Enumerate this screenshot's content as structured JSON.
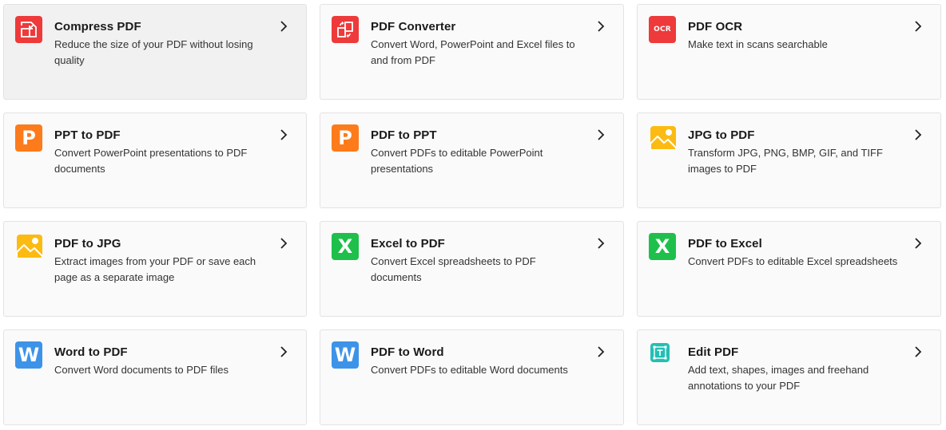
{
  "colors": {
    "red": "#ee3a3a",
    "orange": "#fd7b1b",
    "yellow": "#fbbb12",
    "green": "#1ec04b",
    "blue": "#3d93e8",
    "teal": "#23bfb3"
  },
  "tools": [
    {
      "title": "Compress PDF",
      "description": "Reduce the size of your PDF without losing quality",
      "icon": "compress-icon"
    },
    {
      "title": "PDF Converter",
      "description": "Convert Word, PowerPoint and Excel files to and from PDF",
      "icon": "convert-icon"
    },
    {
      "title": "PDF OCR",
      "description": "Make text in scans searchable",
      "icon": "ocr-icon",
      "icon_text": "OCR"
    },
    {
      "title": "PPT to PDF",
      "description": "Convert PowerPoint presentations to PDF documents",
      "icon": "powerpoint-icon",
      "icon_text": "P"
    },
    {
      "title": "PDF to PPT",
      "description": "Convert PDFs to editable PowerPoint presentations",
      "icon": "powerpoint-icon",
      "icon_text": "P"
    },
    {
      "title": "JPG to PDF",
      "description": "Transform JPG, PNG, BMP, GIF, and TIFF images to PDF",
      "icon": "image-icon"
    },
    {
      "title": "PDF to JPG",
      "description": "Extract images from your PDF or save each page as a separate image",
      "icon": "image-icon"
    },
    {
      "title": "Excel to PDF",
      "description": "Convert Excel spreadsheets to PDF documents",
      "icon": "excel-icon",
      "icon_text": "X"
    },
    {
      "title": "PDF to Excel",
      "description": "Convert PDFs to editable Excel spreadsheets",
      "icon": "excel-icon",
      "icon_text": "X"
    },
    {
      "title": "Word to PDF",
      "description": "Convert Word documents to PDF files",
      "icon": "word-icon",
      "icon_text": "W"
    },
    {
      "title": "PDF to Word",
      "description": "Convert PDFs to editable Word documents",
      "icon": "word-icon",
      "icon_text": "W"
    },
    {
      "title": "Edit PDF",
      "description": "Add text, shapes, images and freehand annotations to your PDF",
      "icon": "edit-text-icon"
    }
  ]
}
